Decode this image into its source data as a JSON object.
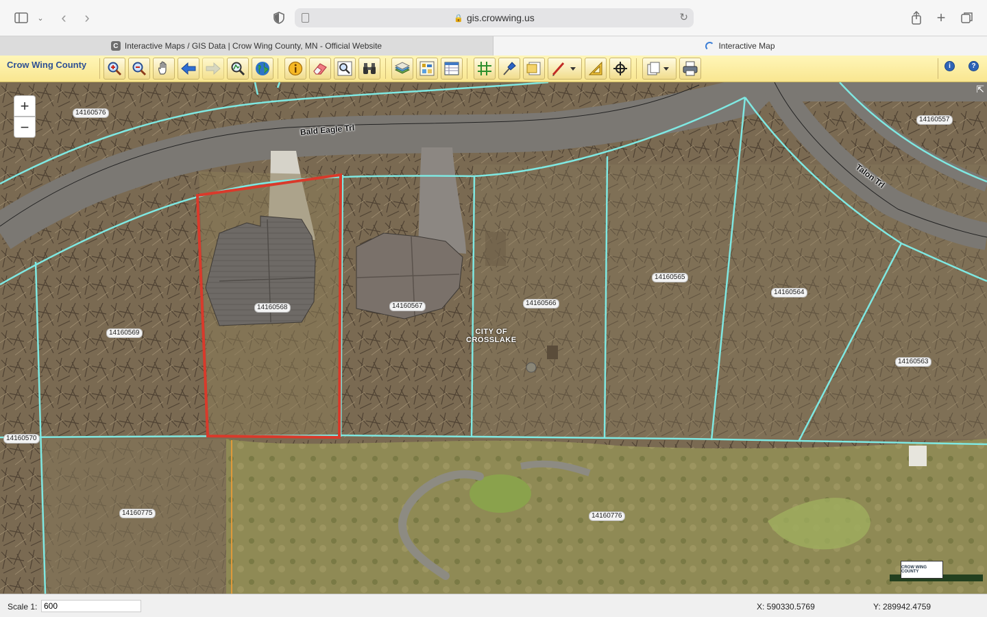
{
  "browser": {
    "url": "gis.crowwing.us",
    "tabs": [
      {
        "title": "Interactive Maps / GIS Data | Crow Wing County, MN - Official Website",
        "favicon": "C"
      },
      {
        "title": "Interactive Map"
      }
    ]
  },
  "gis": {
    "county_name": "Crow Wing County",
    "tools": [
      "zoom-in-tool-icon",
      "zoom-out-tool-icon",
      "pan-hand-icon",
      "back-arrow-icon",
      "forward-arrow-icon",
      "zoom-extent-icon",
      "globe-icon",
      "identify-icon",
      "eraser-icon",
      "magnify-icon",
      "binoculars-icon",
      "layers-icon",
      "legend-icon",
      "table-icon",
      "grid-icon",
      "pin-icon",
      "note-icon",
      "pencil-icon",
      "measure-icon",
      "locate-icon",
      "copy-icon",
      "print-icon",
      "info-icon",
      "help-icon"
    ]
  },
  "map": {
    "zoom_in": "+",
    "zoom_out": "−",
    "parcels": [
      "14160576",
      "14160557",
      "14160568",
      "14160567",
      "14160566",
      "14160565",
      "14160564",
      "14160563",
      "14160569",
      "14160570",
      "14160775",
      "14160776"
    ],
    "roads": [
      "Bald Eagle Trl",
      "Talon Trl"
    ],
    "city_label": [
      "CITY OF",
      "CROSSLAKE"
    ],
    "logo_text": "CROW WING COUNTY",
    "colors": {
      "parcel_line": "#7fe8e2",
      "selection": "#d93a2b",
      "road": "#7b7873"
    }
  },
  "status": {
    "scale_label": "Scale 1:",
    "scale_value": "600",
    "x": "X: 590330.5769",
    "y": "Y: 289942.4759"
  }
}
